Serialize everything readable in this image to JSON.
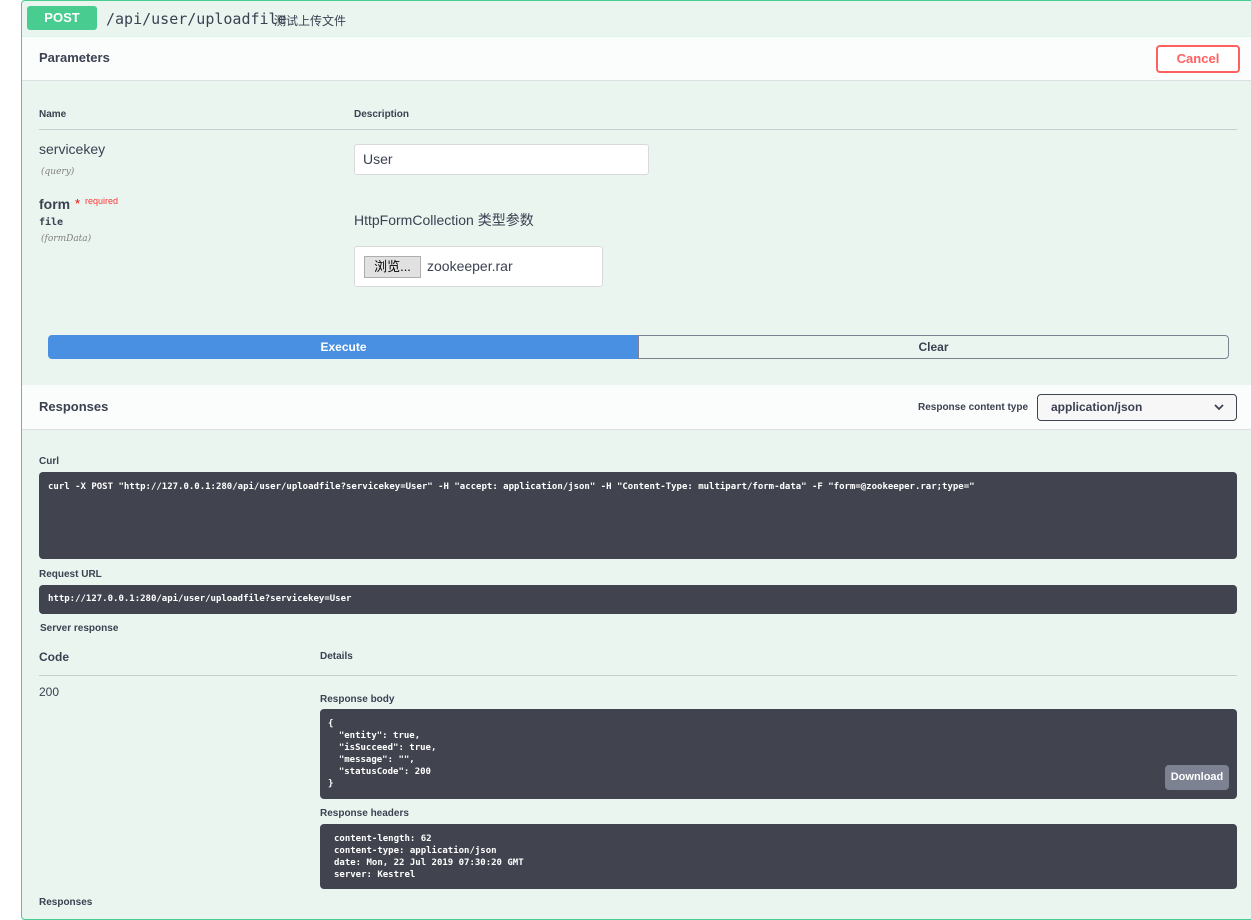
{
  "operation": {
    "method": "POST",
    "path": "/api/user/uploadfile",
    "summary": "测试上传文件"
  },
  "parameters": {
    "title": "Parameters",
    "cancel_label": "Cancel",
    "col_name": "Name",
    "col_description": "Description",
    "items": [
      {
        "name": "servicekey",
        "in": "(query)",
        "value": "User"
      },
      {
        "name": "form",
        "required_star": "*",
        "required_label": "required",
        "type": "file",
        "in": "(formData)",
        "description": "HttpFormCollection 类型参数",
        "browse_label": "浏览...",
        "file_name": "zookeeper.rar"
      }
    ]
  },
  "actions": {
    "execute_label": "Execute",
    "clear_label": "Clear"
  },
  "responses": {
    "title": "Responses",
    "content_type_label": "Response content type",
    "content_type_value": "application/json",
    "curl_label": "Curl",
    "curl_command": "curl -X POST \"http://127.0.0.1:280/api/user/uploadfile?servicekey=User\" -H \"accept: application/json\" -H \"Content-Type: multipart/form-data\" -F \"form=@zookeeper.rar;type=\"",
    "request_url_label": "Request URL",
    "request_url": "http://127.0.0.1:280/api/user/uploadfile?servicekey=User",
    "server_response_label": "Server response",
    "code_header": "Code",
    "details_header": "Details",
    "code": "200",
    "body_label": "Response body",
    "body": "{\n  \"entity\": true,\n  \"isSucceed\": true,\n  \"message\": \"\",\n  \"statusCode\": 200\n}",
    "download_label": "Download",
    "headers_label": "Response headers",
    "headers": "content-length: 62\ncontent-type: application/json\ndate: Mon, 22 Jul 2019 07:30:20 GMT\nserver: Kestrel",
    "footer_label": "Responses"
  }
}
